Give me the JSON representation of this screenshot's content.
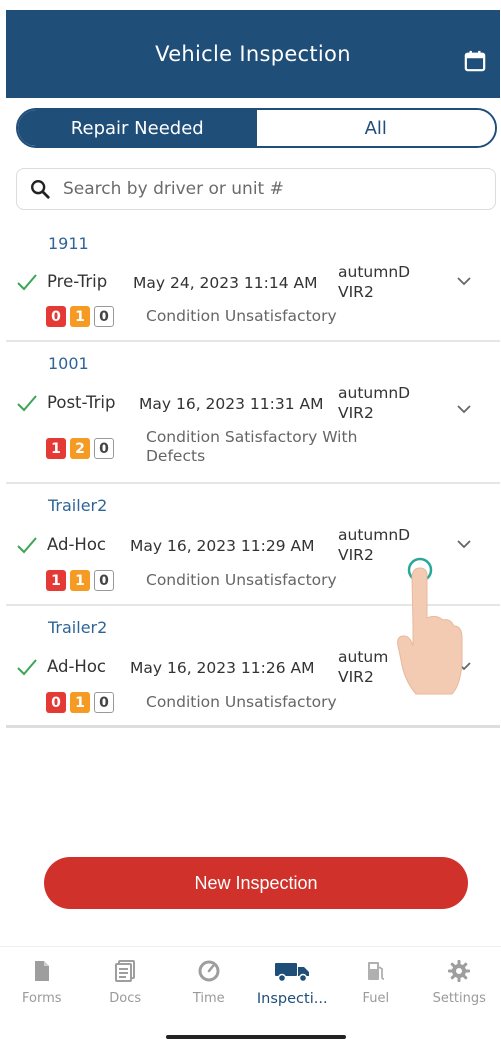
{
  "header": {
    "title": "Vehicle Inspection",
    "calendar_icon": "calendar-icon"
  },
  "segment": {
    "repair_label": "Repair Needed",
    "all_label": "All",
    "selected": "Repair Needed"
  },
  "search": {
    "placeholder": "Search by driver or unit #",
    "value": "",
    "icon": "search-icon"
  },
  "colors": {
    "brand": "#1f4e79",
    "accent_red": "#d0312a",
    "badge_red": "#e53935",
    "badge_orange": "#f59a23",
    "check_green": "#3aa655"
  },
  "inspections": [
    {
      "unit": "1911",
      "type": "Pre-Trip",
      "date": "May 24, 2023 11:14 AM",
      "driver_line1": "autumnD",
      "driver_line2": "VIR2",
      "badge_red": "0",
      "badge_orange": "1",
      "badge_zero": "0",
      "condition_line1": "Condition Unsatisfactory",
      "condition_line2": ""
    },
    {
      "unit": "1001",
      "type": "Post-Trip",
      "date": "May 16, 2023 11:31 AM",
      "driver_line1": "autumnD",
      "driver_line2": "VIR2",
      "badge_red": "1",
      "badge_orange": "2",
      "badge_zero": "0",
      "condition_line1": "Condition Satisfactory With",
      "condition_line2": "Defects"
    },
    {
      "unit": "Trailer2",
      "type": "Ad-Hoc",
      "date": "May 16, 2023 11:29 AM",
      "driver_line1": "autumnD",
      "driver_line2": "VIR2",
      "badge_red": "1",
      "badge_orange": "1",
      "badge_zero": "0",
      "condition_line1": "Condition Unsatisfactory",
      "condition_line2": ""
    },
    {
      "unit": "Trailer2",
      "type": "Ad-Hoc",
      "date": "May 16, 2023 11:26 AM",
      "driver_line1": "autum",
      "driver_line2": "VIR2",
      "badge_red": "0",
      "badge_orange": "1",
      "badge_zero": "0",
      "condition_line1": "Condition Unsatisfactory",
      "condition_line2": ""
    }
  ],
  "new_inspection_label": "New Inspection",
  "tabs": [
    {
      "label": "Forms",
      "icon": "document-icon"
    },
    {
      "label": "Docs",
      "icon": "docs-icon"
    },
    {
      "label": "Time",
      "icon": "clock-icon"
    },
    {
      "label": "Inspecti...",
      "icon": "truck-icon"
    },
    {
      "label": "Fuel",
      "icon": "fuel-pump-icon"
    },
    {
      "label": "Settings",
      "icon": "gear-icon"
    }
  ],
  "active_tab": "Inspecti..."
}
